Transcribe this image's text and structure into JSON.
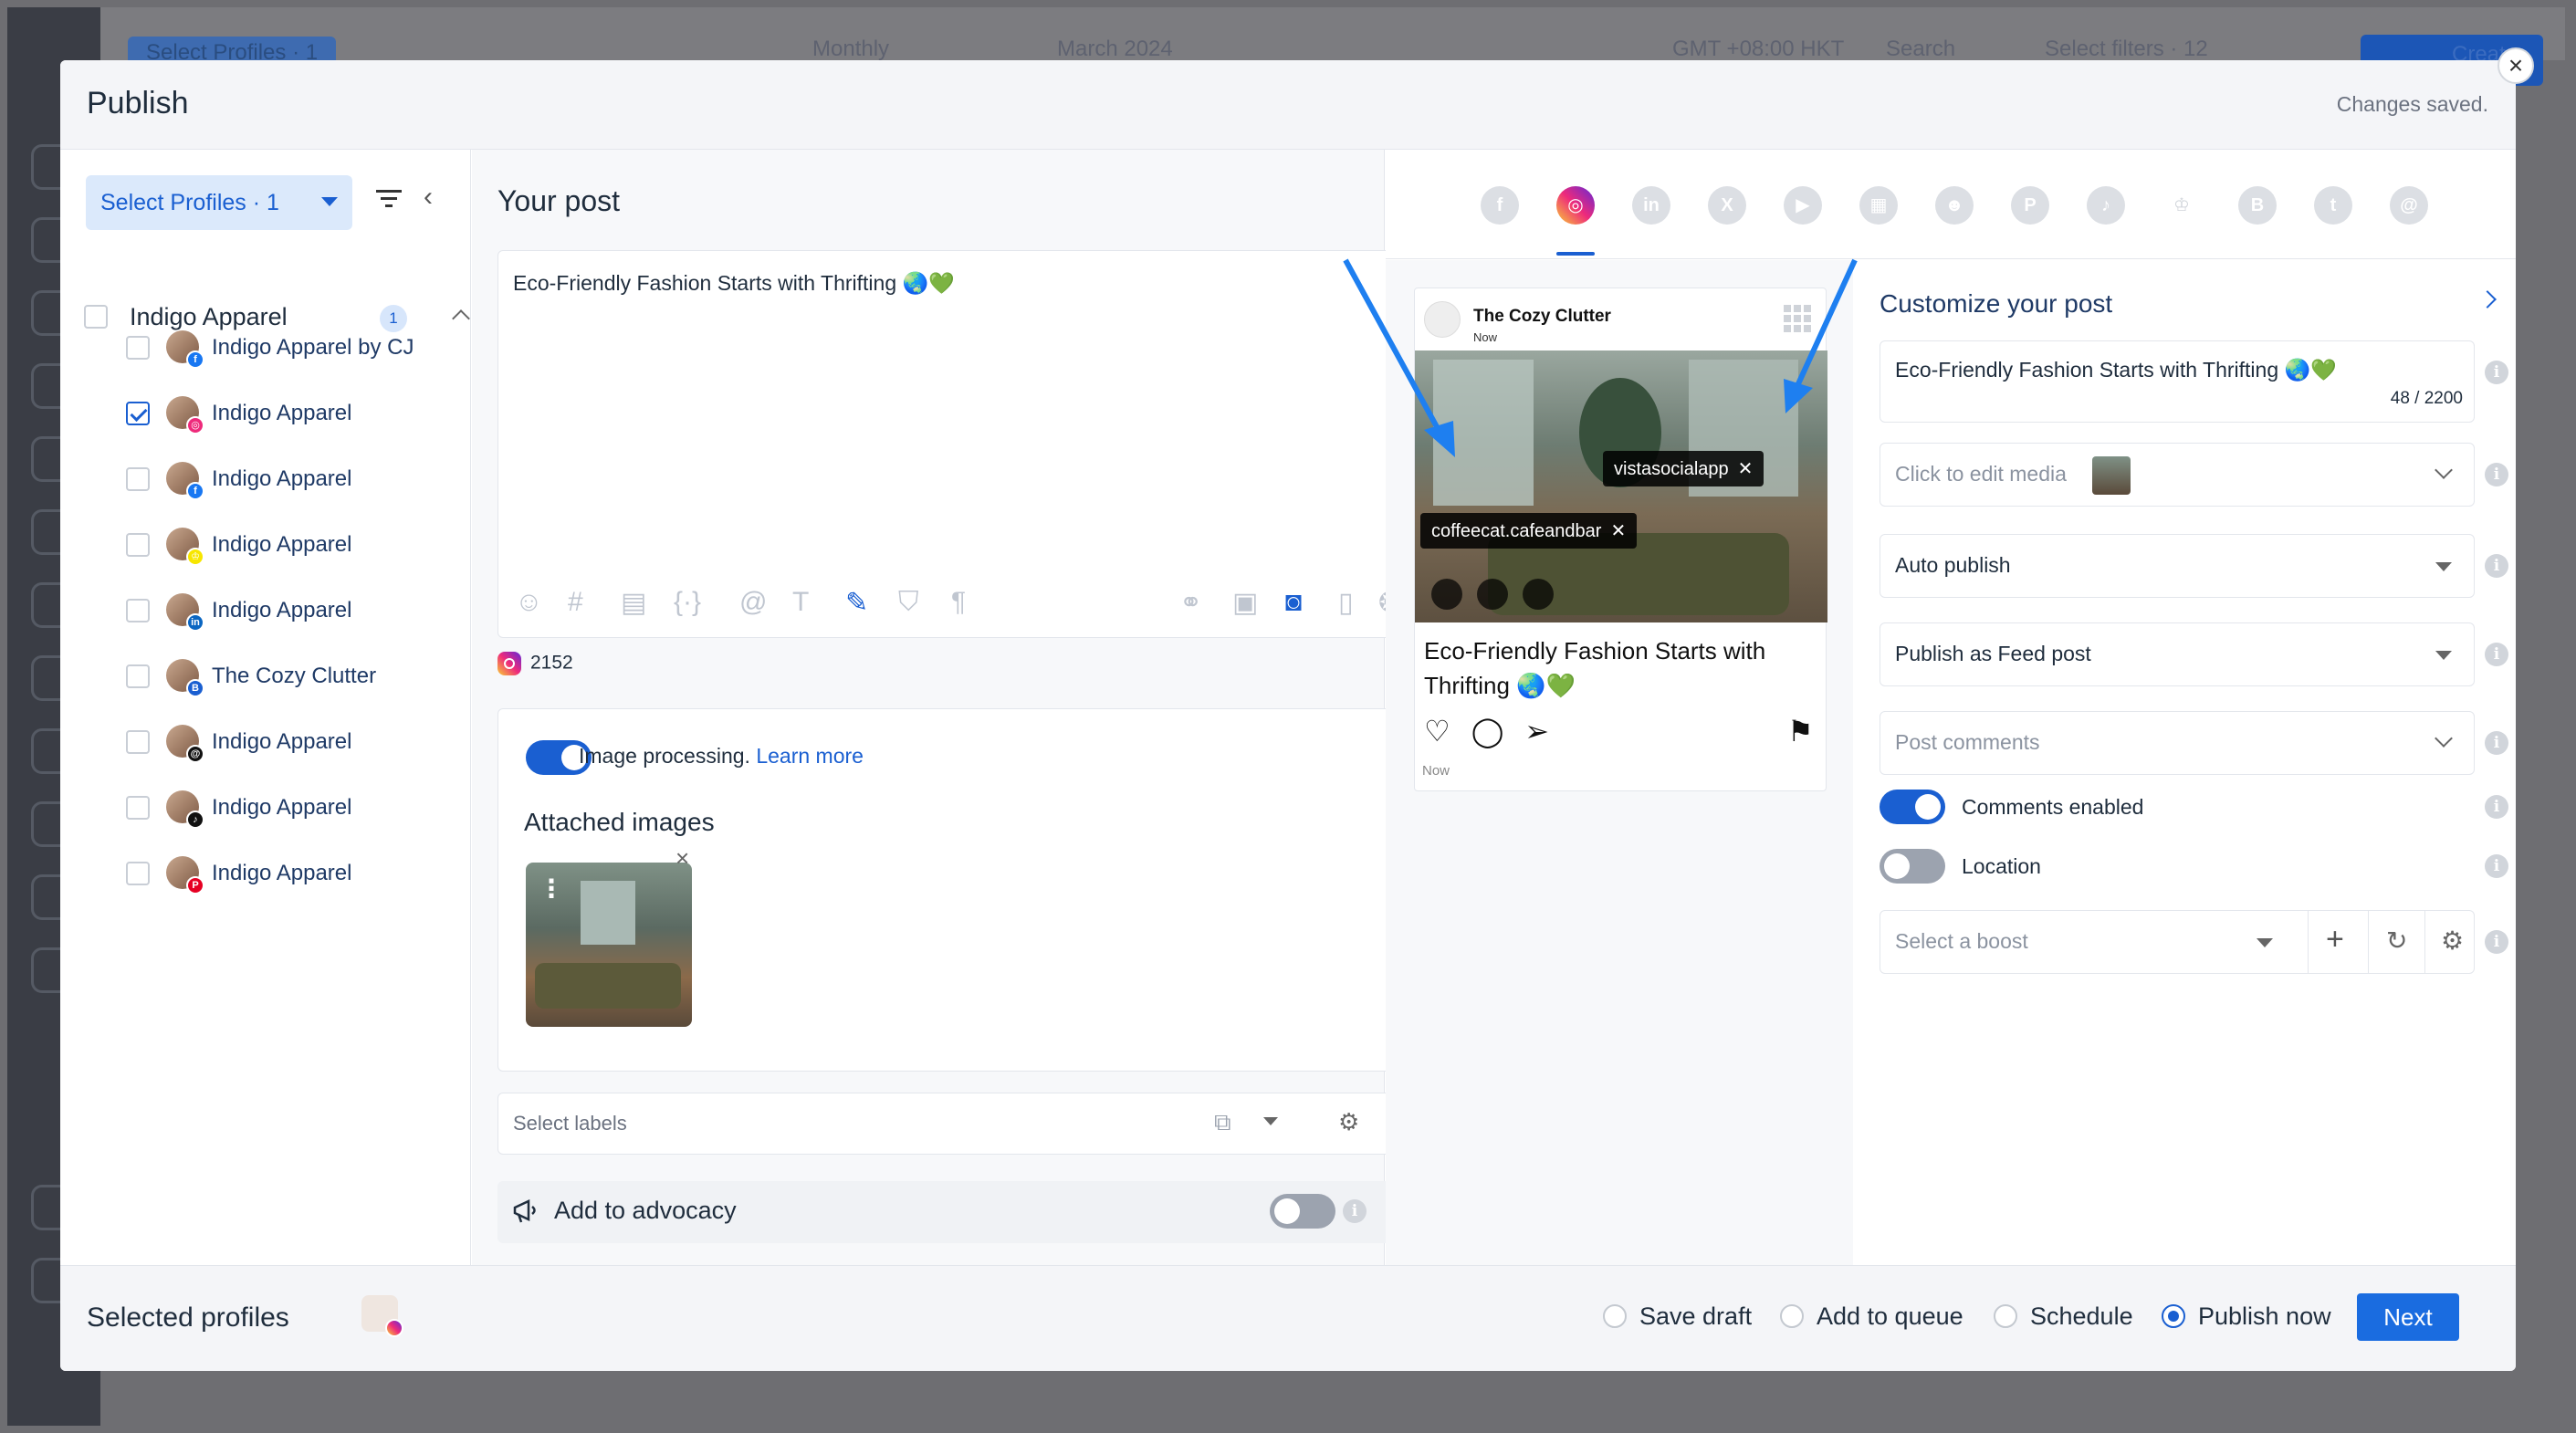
{
  "background": {
    "top_items": [
      "Select Profiles · 1",
      "Monthly",
      "March 2024",
      "GMT +08:00 HKT",
      "Search",
      "Select filters · 12",
      "Create"
    ]
  },
  "modal": {
    "title": "Publish",
    "status": "Changes saved.",
    "close_label": "×"
  },
  "profiles_panel": {
    "select_button": "Select Profiles · 1",
    "group": {
      "name": "Indigo Apparel",
      "count": "1"
    },
    "profiles": [
      {
        "name": "Indigo Apparel by CJ",
        "checked": false,
        "network": "facebook"
      },
      {
        "name": "Indigo Apparel",
        "checked": true,
        "network": "instagram"
      },
      {
        "name": "Indigo Apparel",
        "checked": false,
        "network": "facebook"
      },
      {
        "name": "Indigo Apparel",
        "checked": false,
        "network": "snapchat"
      },
      {
        "name": "Indigo Apparel",
        "checked": false,
        "network": "linkedin"
      },
      {
        "name": "The Cozy Clutter",
        "checked": false,
        "network": "google-business"
      },
      {
        "name": "Indigo Apparel",
        "checked": false,
        "network": "threads"
      },
      {
        "name": "Indigo Apparel",
        "checked": false,
        "network": "tiktok"
      },
      {
        "name": "Indigo Apparel",
        "checked": false,
        "network": "pinterest"
      }
    ]
  },
  "post": {
    "heading": "Your post",
    "text": "Eco-Friendly Fashion Starts with Thrifting 🌏💚",
    "char_count": "2152",
    "image_processing_label": "Image processing.",
    "learn_more": "Learn more",
    "attached_title": "Attached images",
    "labels_placeholder": "Select labels",
    "advocacy_label": "Add to advocacy"
  },
  "networks": [
    "facebook",
    "instagram",
    "linkedin",
    "x",
    "youtube",
    "google-business",
    "reddit",
    "pinterest",
    "tiktok",
    "snapchat",
    "blog",
    "tumblr",
    "threads"
  ],
  "preview": {
    "account_name": "The Cozy Clutter",
    "time": "Now",
    "tags": [
      "vistasocialapp",
      "coffeecat.cafeandbar"
    ],
    "caption": "Eco-Friendly Fashion Starts with Thrifting 🌏💚",
    "footer_time": "Now"
  },
  "customize": {
    "title": "Customize your post",
    "text": "Eco-Friendly Fashion Starts with Thrifting 🌏💚",
    "text_count": "48 / 2200",
    "media_placeholder": "Click to edit media",
    "publish_mode": "Auto publish",
    "publish_as": "Publish as Feed post",
    "comments_placeholder": "Post comments",
    "comments_enabled_label": "Comments enabled",
    "comments_enabled": true,
    "location_label": "Location",
    "location_enabled": false,
    "boost_placeholder": "Select a boost"
  },
  "footer": {
    "selected_profiles_label": "Selected profiles",
    "options": [
      {
        "label": "Save draft",
        "selected": false
      },
      {
        "label": "Add to queue",
        "selected": false
      },
      {
        "label": "Schedule",
        "selected": false
      },
      {
        "label": "Publish now",
        "selected": true
      }
    ],
    "next_label": "Next"
  },
  "colors": {
    "accent": "#1a5fd1",
    "instagram": "#ee2a7b",
    "backdrop": "#6e6e72"
  }
}
